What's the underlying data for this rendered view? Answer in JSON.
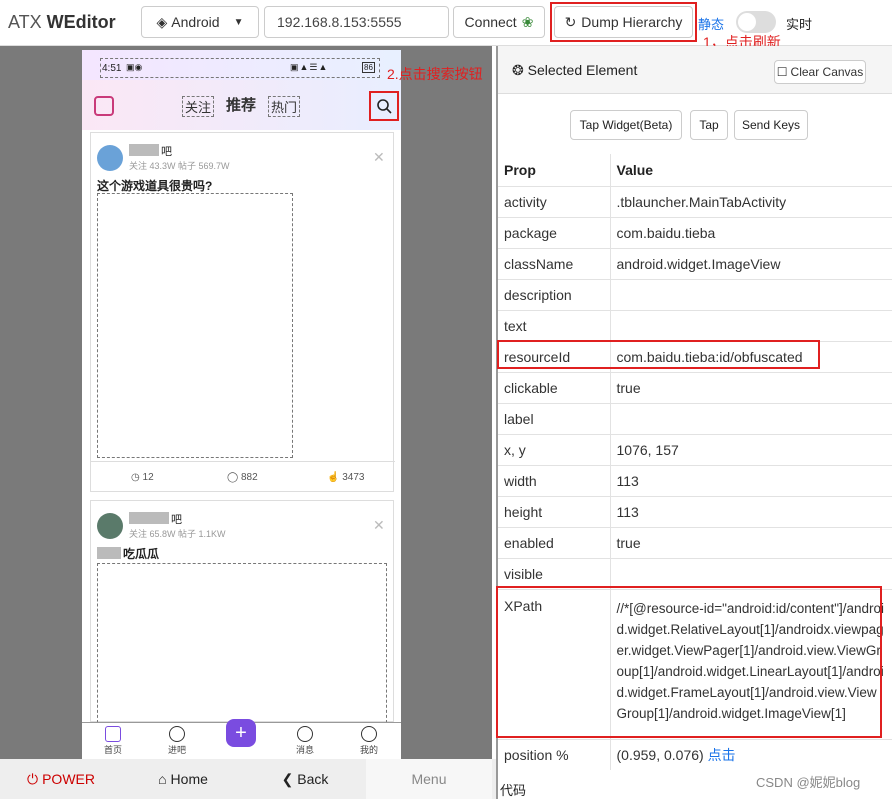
{
  "header": {
    "brand_prefix": "ATX ",
    "brand_name": "WEditor",
    "platform": "Android",
    "device_address": "192.168.8.153:5555",
    "connect_label": "Connect",
    "dump_label": "Dump Hierarchy",
    "mode_static": "静态",
    "mode_realtime": "实时"
  },
  "annotations": {
    "step1": "1，点击刷新",
    "step2": "2.点击搜索按钮"
  },
  "phone": {
    "time": "4:51",
    "battery": "86",
    "tabs": [
      "关注",
      "推荐",
      "热门"
    ],
    "posts": [
      {
        "forum": "吧",
        "stats": "关注 43.3W  帖子 569.7W",
        "title": "这个游戏道具很贵吗?",
        "actions": [
          "12",
          "882",
          "3473"
        ]
      },
      {
        "forum": "吧",
        "stats": "关注 65.8W  帖子 1.1KW",
        "title": "吃瓜瓜"
      }
    ],
    "nav": [
      "首页",
      "进吧",
      "",
      "消息",
      "我的"
    ]
  },
  "device_controls": {
    "power": "POWER",
    "home": "Home",
    "back": "Back",
    "menu": "Menu"
  },
  "panel": {
    "title": "Selected Element",
    "clear_canvas": "Clear Canvas",
    "tap_widget": "Tap Widget(Beta)",
    "tap": "Tap",
    "send_keys": "Send Keys",
    "col_prop": "Prop",
    "col_value": "Value",
    "rows": [
      {
        "k": "activity",
        "v": ".tblauncher.MainTabActivity"
      },
      {
        "k": "package",
        "v": "com.baidu.tieba"
      },
      {
        "k": "className",
        "v": "android.widget.ImageView"
      },
      {
        "k": "description",
        "v": ""
      },
      {
        "k": "text",
        "v": ""
      },
      {
        "k": "resourceId",
        "v": "com.baidu.tieba:id/obfuscated"
      },
      {
        "k": "clickable",
        "v": "true"
      },
      {
        "k": "label",
        "v": ""
      },
      {
        "k": "x, y",
        "v": "1076, 157"
      },
      {
        "k": "width",
        "v": "113"
      },
      {
        "k": "height",
        "v": "113"
      },
      {
        "k": "enabled",
        "v": "true"
      },
      {
        "k": "visible",
        "v": ""
      }
    ],
    "xpath_label": "XPath",
    "xpath_value": "//*[@resource-id=\"android:id/content\"]/android.widget.RelativeLayout[1]/androidx.viewpager.widget.ViewPager[1]/android.view.ViewGroup[1]/android.widget.LinearLayout[1]/android.widget.FrameLayout[1]/android.view.ViewGroup[1]/android.widget.ImageView[1]",
    "position_label": "position %",
    "position_value": "(0.959, 0.076)",
    "position_link": "点击",
    "code_label": "代码"
  },
  "watermark": "CSDN @妮妮blog"
}
